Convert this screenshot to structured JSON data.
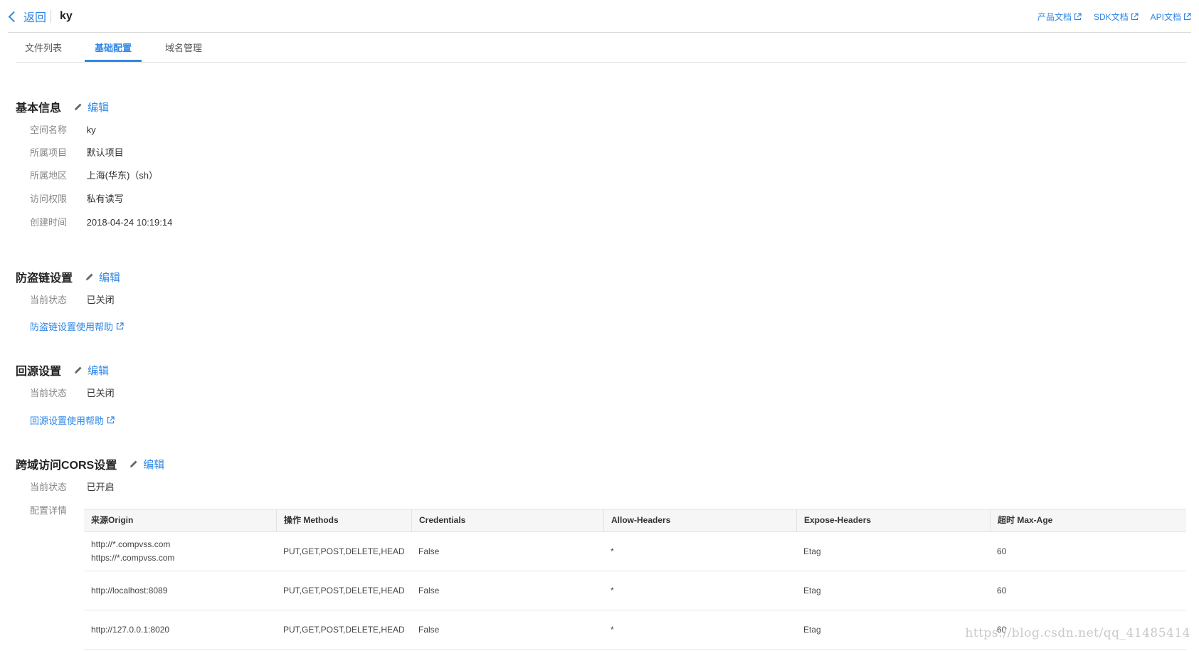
{
  "header": {
    "back_label": "返回",
    "bucket_name": "ky",
    "doc_links": [
      "产品文档",
      "SDK文档",
      "API文档"
    ]
  },
  "tabs": [
    {
      "label": "文件列表",
      "active": false
    },
    {
      "label": "基础配置",
      "active": true
    },
    {
      "label": "域名管理",
      "active": false
    }
  ],
  "edit_label": "编辑",
  "basic_info": {
    "title": "基本信息",
    "rows": [
      {
        "label": "空间名称",
        "value": "ky"
      },
      {
        "label": "所属项目",
        "value": "默认项目"
      },
      {
        "label": "所属地区",
        "value": "上海(华东)（sh）"
      },
      {
        "label": "访问权限",
        "value": "私有读写"
      },
      {
        "label": "创建时间",
        "value": "2018-04-24 10:19:14"
      }
    ]
  },
  "hotlink": {
    "title": "防盗链设置",
    "status_label": "当前状态",
    "status_value": "已关闭",
    "help_link": "防盗链设置使用帮助"
  },
  "origin": {
    "title": "回源设置",
    "status_label": "当前状态",
    "status_value": "已关闭",
    "help_link": "回源设置使用帮助"
  },
  "cors": {
    "title": "跨域访问CORS设置",
    "status_label": "当前状态",
    "status_value": "已开启",
    "detail_label": "配置详情",
    "columns": [
      "来源Origin",
      "操作 Methods",
      "Credentials",
      "Allow-Headers",
      "Expose-Headers",
      "超时 Max-Age"
    ],
    "rows": [
      {
        "origin_1": "http://*.compvss.com",
        "origin_2": "https://*.compvss.com",
        "methods": "PUT,GET,POST,DELETE,HEAD",
        "credentials": "False",
        "allow_headers": "*",
        "expose_headers": "Etag",
        "max_age": "60"
      },
      {
        "origin_1": "http://localhost:8089",
        "origin_2": "",
        "methods": "PUT,GET,POST,DELETE,HEAD",
        "credentials": "False",
        "allow_headers": "*",
        "expose_headers": "Etag",
        "max_age": "60"
      },
      {
        "origin_1": "http://127.0.0.1:8020",
        "origin_2": "",
        "methods": "PUT,GET,POST,DELETE,HEAD",
        "credentials": "False",
        "allow_headers": "*",
        "expose_headers": "Etag",
        "max_age": "60"
      }
    ]
  },
  "watermark": "https://blog.csdn.net/qq_41485414",
  "colors": {
    "accent": "#2f87e5",
    "label_gray": "#888888",
    "border": "#e3e3e3"
  }
}
